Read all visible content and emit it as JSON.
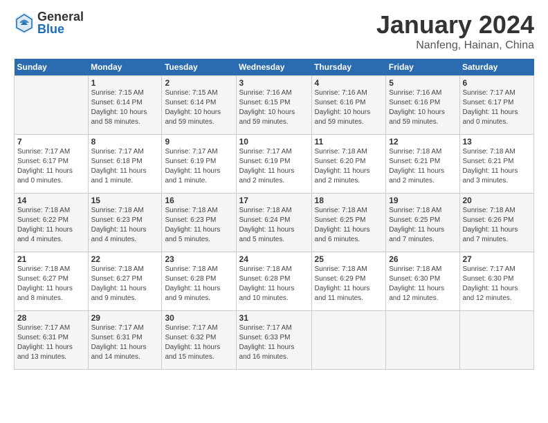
{
  "logo": {
    "general": "General",
    "blue": "Blue"
  },
  "header": {
    "month": "January 2024",
    "location": "Nanfeng, Hainan, China"
  },
  "weekdays": [
    "Sunday",
    "Monday",
    "Tuesday",
    "Wednesday",
    "Thursday",
    "Friday",
    "Saturday"
  ],
  "weeks": [
    [
      {
        "day": "",
        "info": ""
      },
      {
        "day": "1",
        "info": "Sunrise: 7:15 AM\nSunset: 6:14 PM\nDaylight: 10 hours\nand 58 minutes."
      },
      {
        "day": "2",
        "info": "Sunrise: 7:15 AM\nSunset: 6:14 PM\nDaylight: 10 hours\nand 59 minutes."
      },
      {
        "day": "3",
        "info": "Sunrise: 7:16 AM\nSunset: 6:15 PM\nDaylight: 10 hours\nand 59 minutes."
      },
      {
        "day": "4",
        "info": "Sunrise: 7:16 AM\nSunset: 6:16 PM\nDaylight: 10 hours\nand 59 minutes."
      },
      {
        "day": "5",
        "info": "Sunrise: 7:16 AM\nSunset: 6:16 PM\nDaylight: 10 hours\nand 59 minutes."
      },
      {
        "day": "6",
        "info": "Sunrise: 7:17 AM\nSunset: 6:17 PM\nDaylight: 11 hours\nand 0 minutes."
      }
    ],
    [
      {
        "day": "7",
        "info": "Sunrise: 7:17 AM\nSunset: 6:17 PM\nDaylight: 11 hours\nand 0 minutes."
      },
      {
        "day": "8",
        "info": "Sunrise: 7:17 AM\nSunset: 6:18 PM\nDaylight: 11 hours\nand 1 minute."
      },
      {
        "day": "9",
        "info": "Sunrise: 7:17 AM\nSunset: 6:19 PM\nDaylight: 11 hours\nand 1 minute."
      },
      {
        "day": "10",
        "info": "Sunrise: 7:17 AM\nSunset: 6:19 PM\nDaylight: 11 hours\nand 2 minutes."
      },
      {
        "day": "11",
        "info": "Sunrise: 7:18 AM\nSunset: 6:20 PM\nDaylight: 11 hours\nand 2 minutes."
      },
      {
        "day": "12",
        "info": "Sunrise: 7:18 AM\nSunset: 6:21 PM\nDaylight: 11 hours\nand 2 minutes."
      },
      {
        "day": "13",
        "info": "Sunrise: 7:18 AM\nSunset: 6:21 PM\nDaylight: 11 hours\nand 3 minutes."
      }
    ],
    [
      {
        "day": "14",
        "info": "Sunrise: 7:18 AM\nSunset: 6:22 PM\nDaylight: 11 hours\nand 4 minutes."
      },
      {
        "day": "15",
        "info": "Sunrise: 7:18 AM\nSunset: 6:23 PM\nDaylight: 11 hours\nand 4 minutes."
      },
      {
        "day": "16",
        "info": "Sunrise: 7:18 AM\nSunset: 6:23 PM\nDaylight: 11 hours\nand 5 minutes."
      },
      {
        "day": "17",
        "info": "Sunrise: 7:18 AM\nSunset: 6:24 PM\nDaylight: 11 hours\nand 5 minutes."
      },
      {
        "day": "18",
        "info": "Sunrise: 7:18 AM\nSunset: 6:25 PM\nDaylight: 11 hours\nand 6 minutes."
      },
      {
        "day": "19",
        "info": "Sunrise: 7:18 AM\nSunset: 6:25 PM\nDaylight: 11 hours\nand 7 minutes."
      },
      {
        "day": "20",
        "info": "Sunrise: 7:18 AM\nSunset: 6:26 PM\nDaylight: 11 hours\nand 7 minutes."
      }
    ],
    [
      {
        "day": "21",
        "info": "Sunrise: 7:18 AM\nSunset: 6:27 PM\nDaylight: 11 hours\nand 8 minutes."
      },
      {
        "day": "22",
        "info": "Sunrise: 7:18 AM\nSunset: 6:27 PM\nDaylight: 11 hours\nand 9 minutes."
      },
      {
        "day": "23",
        "info": "Sunrise: 7:18 AM\nSunset: 6:28 PM\nDaylight: 11 hours\nand 9 minutes."
      },
      {
        "day": "24",
        "info": "Sunrise: 7:18 AM\nSunset: 6:28 PM\nDaylight: 11 hours\nand 10 minutes."
      },
      {
        "day": "25",
        "info": "Sunrise: 7:18 AM\nSunset: 6:29 PM\nDaylight: 11 hours\nand 11 minutes."
      },
      {
        "day": "26",
        "info": "Sunrise: 7:18 AM\nSunset: 6:30 PM\nDaylight: 11 hours\nand 12 minutes."
      },
      {
        "day": "27",
        "info": "Sunrise: 7:17 AM\nSunset: 6:30 PM\nDaylight: 11 hours\nand 12 minutes."
      }
    ],
    [
      {
        "day": "28",
        "info": "Sunrise: 7:17 AM\nSunset: 6:31 PM\nDaylight: 11 hours\nand 13 minutes."
      },
      {
        "day": "29",
        "info": "Sunrise: 7:17 AM\nSunset: 6:31 PM\nDaylight: 11 hours\nand 14 minutes."
      },
      {
        "day": "30",
        "info": "Sunrise: 7:17 AM\nSunset: 6:32 PM\nDaylight: 11 hours\nand 15 minutes."
      },
      {
        "day": "31",
        "info": "Sunrise: 7:17 AM\nSunset: 6:33 PM\nDaylight: 11 hours\nand 16 minutes."
      },
      {
        "day": "",
        "info": ""
      },
      {
        "day": "",
        "info": ""
      },
      {
        "day": "",
        "info": ""
      }
    ]
  ]
}
